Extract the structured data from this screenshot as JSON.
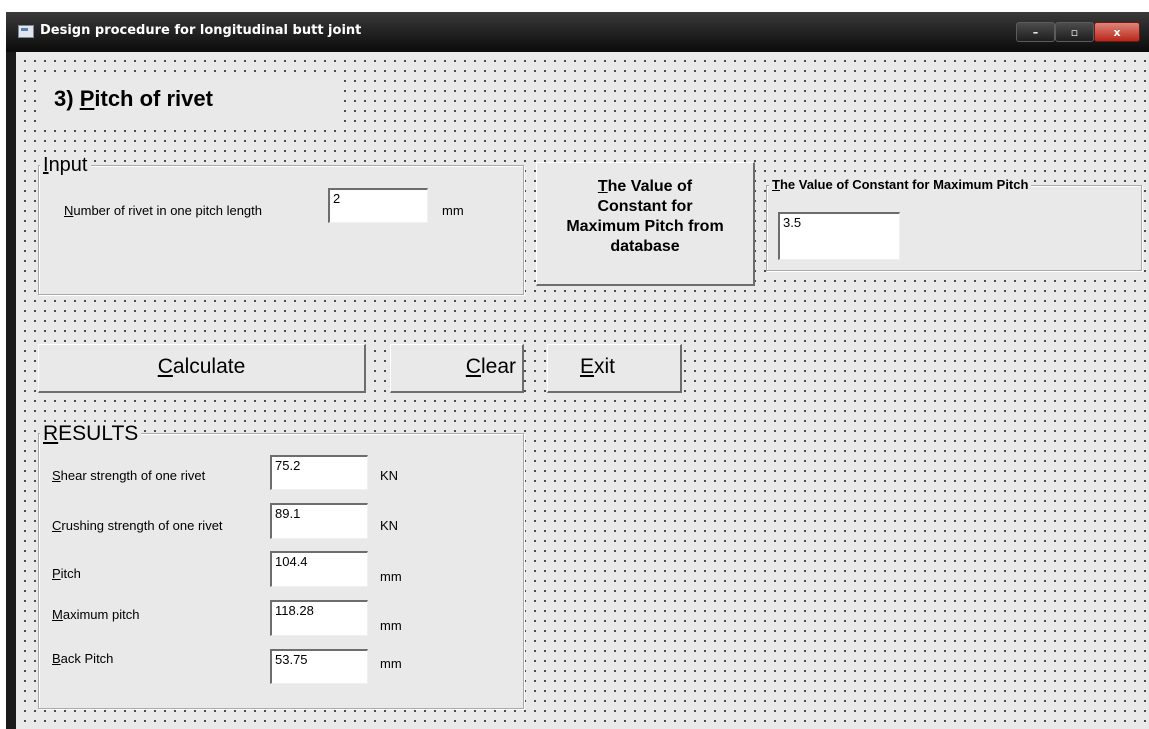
{
  "window": {
    "title": "Design procedure for longitudinal butt joint",
    "controls": {
      "minimize": "–",
      "maximize": "▫",
      "close": "x"
    }
  },
  "heading": {
    "accel": "3) ",
    "ul": "P",
    "rest": "itch of rivet"
  },
  "input_frame": {
    "caption_ul": "I",
    "caption_rest": "nput",
    "rivets_label_ul": "N",
    "rivets_label_rest": "umber of rivet in one pitch length",
    "rivets_value": "2",
    "rivets_unit": "mm"
  },
  "constant_button": {
    "ul": "T",
    "line1_rest": "he Value of",
    "line2": "Constant for",
    "line3": "Maximum Pitch from",
    "line4": "database"
  },
  "constant_frame": {
    "caption_ul": "T",
    "caption_rest": "he Value of Constant for Maximum Pitch",
    "value": "3.5"
  },
  "actions": {
    "calculate_ul": "C",
    "calculate_rest": "alculate",
    "clear_ul": "C",
    "clear_rest": "lear",
    "exit_ul": "E",
    "exit_rest": "xit"
  },
  "results": {
    "caption_ul": "R",
    "caption_rest": "ESULTS",
    "rows": [
      {
        "label_ul": "S",
        "label_rest": "hear strength of one rivet",
        "value": "75.2",
        "unit": "KN"
      },
      {
        "label_ul": "C",
        "label_rest": "rushing strength of one rivet",
        "value": "89.1",
        "unit": "KN"
      },
      {
        "label_ul": "P",
        "label_rest": "itch",
        "value": "104.4",
        "unit": "mm"
      },
      {
        "label_ul": "M",
        "label_rest": "aximum pitch",
        "value": "118.28",
        "unit": "mm"
      },
      {
        "label_ul": "B",
        "label_rest": "ack Pitch",
        "value": "53.75",
        "unit": "mm"
      }
    ]
  }
}
